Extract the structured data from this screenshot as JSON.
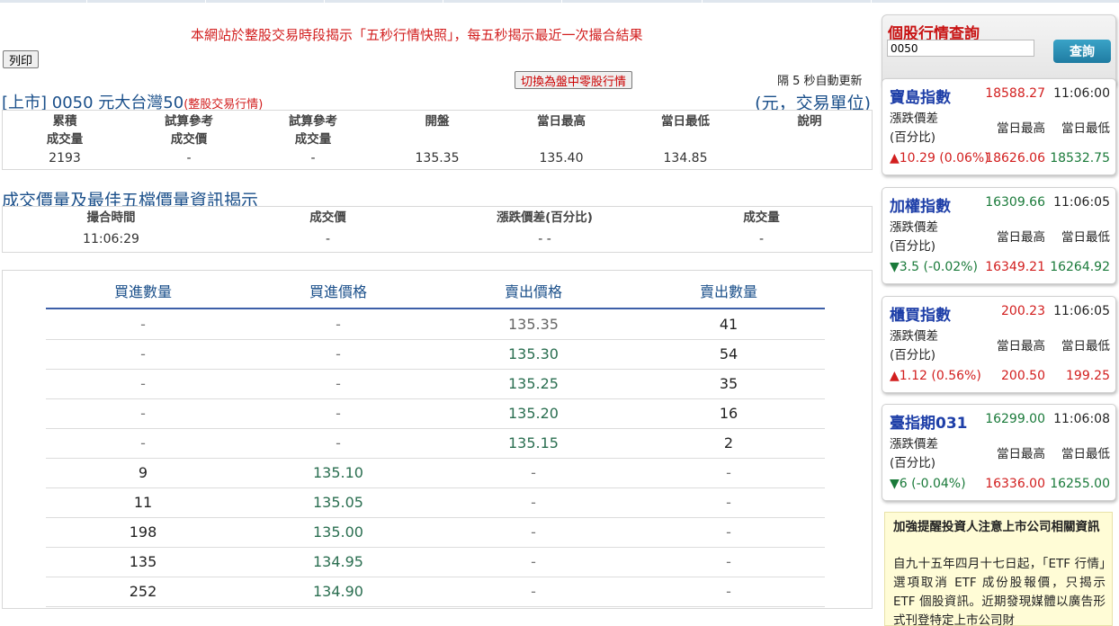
{
  "notice": "本網站於整股交易時段揭示「五秒行情快照」，每五秒揭示最近一次撮合結果",
  "print_label": "列印",
  "switch_label": "切換為盤中零股行情",
  "refresh_text": "隔 5 秒自動更新",
  "stock": {
    "title": "[上市] 0050 元大台灣50",
    "subtitle": "(整股交易行情)",
    "unit": "(元，交易單位)"
  },
  "summary": {
    "headers": [
      [
        "累積",
        "成交量"
      ],
      [
        "試算參考",
        "成交價"
      ],
      [
        "試算參考",
        "成交量"
      ],
      [
        "開盤",
        ""
      ],
      [
        "當日最高",
        ""
      ],
      [
        "當日最低",
        ""
      ],
      [
        "說明",
        ""
      ]
    ],
    "values": [
      "2193",
      "-",
      "-",
      "135.35",
      "135.40",
      "134.85",
      ""
    ]
  },
  "trade_section": {
    "title": "成交價量及最佳五檔價量資訊揭示",
    "headers": [
      "撮合時間",
      "成交價",
      "漲跌價差(百分比)",
      "成交量"
    ],
    "values": [
      "11:06:29",
      "-",
      "- -",
      "-"
    ]
  },
  "orderbook": {
    "headers": [
      "買進數量",
      "買進價格",
      "賣出價格",
      "賣出數量"
    ],
    "rows": [
      [
        "-",
        "-",
        "135.35",
        "41"
      ],
      [
        "-",
        "-",
        "135.30",
        "54"
      ],
      [
        "-",
        "-",
        "135.25",
        "35"
      ],
      [
        "-",
        "-",
        "135.20",
        "16"
      ],
      [
        "-",
        "-",
        "135.15",
        "2"
      ],
      [
        "9",
        "135.10",
        "-",
        "-"
      ],
      [
        "11",
        "135.05",
        "-",
        "-"
      ],
      [
        "198",
        "135.00",
        "-",
        "-"
      ],
      [
        "135",
        "134.95",
        "-",
        "-"
      ],
      [
        "252",
        "134.90",
        "-",
        "-"
      ]
    ]
  },
  "query": {
    "title": "個股行情查詢",
    "input_value": "0050",
    "button_label": "查詢"
  },
  "indices": [
    {
      "name": "寶島指數",
      "price": "18588.27",
      "time": "11:06:00",
      "label1": "漲跌價差",
      "label2": "(百分比)",
      "high_label": "當日最高",
      "low_label": "當日最低",
      "change": "▲10.29 (0.06%)",
      "high": "18626.06",
      "low": "18532.75",
      "direction": "up"
    },
    {
      "name": "加權指數",
      "price": "16309.66",
      "time": "11:06:05",
      "label1": "漲跌價差",
      "label2": "(百分比)",
      "high_label": "當日最高",
      "low_label": "當日最低",
      "change": "▼3.5 (-0.02%)",
      "high": "16349.21",
      "low": "16264.92",
      "direction": "down"
    },
    {
      "name": "櫃買指數",
      "price": "200.23",
      "time": "11:06:05",
      "label1": "漲跌價差",
      "label2": "(百分比)",
      "high_label": "當日最高",
      "low_label": "當日最低",
      "change": "▲1.12 (0.56%)",
      "high": "200.50",
      "low": "199.25",
      "direction": "up"
    },
    {
      "name": "臺指期031",
      "price": "16299.00",
      "time": "11:06:08",
      "label1": "漲跌價差",
      "label2": "(百分比)",
      "high_label": "當日最高",
      "low_label": "當日最低",
      "change": "▼6 (-0.04%)",
      "high": "16336.00",
      "low": "16255.00",
      "direction": "down"
    }
  ],
  "alert": {
    "title": "加強提醒投資人注意上市公司相關資訊",
    "body": "自九十五年四月十七日起，「ETF 行情」選項取消 ETF 成份股報價，只揭示 ETF 個股資訊。近期發現媒體以廣告形式刊登特定上市公司財"
  },
  "colors": {
    "up": "#d21e1e",
    "down": "#1a7a3a",
    "index_name": "#1e3fa8",
    "title_blue": "#1a4f8a"
  }
}
